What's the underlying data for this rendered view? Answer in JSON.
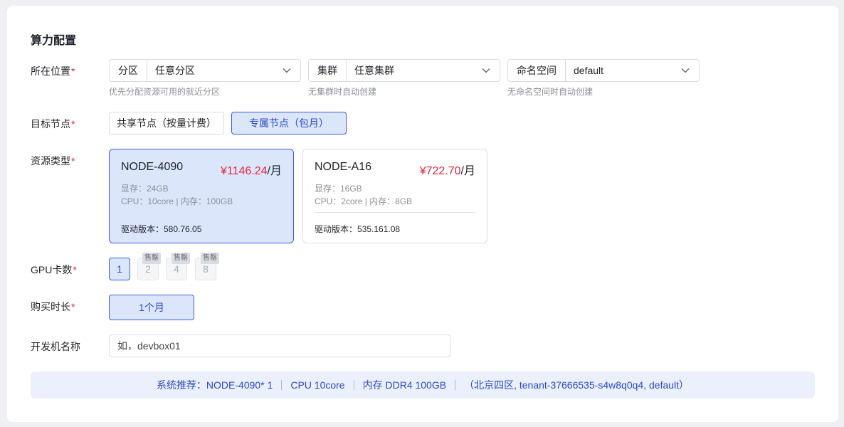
{
  "section_title": "算力配置",
  "location": {
    "label": "所在位置",
    "required_mark": "*",
    "partition": {
      "prefix": "分区",
      "value": "任意分区",
      "hint": "优先分配资源可用的就近分区"
    },
    "cluster": {
      "prefix": "集群",
      "value": "任意集群",
      "hint": "无集群时自动创建"
    },
    "namespace": {
      "prefix": "命名空间",
      "value": "default",
      "hint": "无命名空间时自动创建"
    }
  },
  "target_node": {
    "label": "目标节点",
    "required_mark": "*",
    "options": [
      {
        "label": "共享节点（按量计费）",
        "selected": false
      },
      {
        "label": "专属节点（包月）",
        "selected": true
      }
    ]
  },
  "resource_type": {
    "label": "资源类型",
    "required_mark": "*",
    "cards": [
      {
        "name": "NODE-4090",
        "price": "¥1146.24",
        "unit": "/月",
        "vram": "显存：24GB",
        "cpu_mem": "CPU：10core | 内存：100GB",
        "driver": "驱动版本：580.76.05",
        "selected": true
      },
      {
        "name": "NODE-A16",
        "price": "¥722.70",
        "unit": "/月",
        "vram": "显存：16GB",
        "cpu_mem": "CPU：2core | 内存：8GB",
        "driver": "驱动版本：535.161.08",
        "selected": false
      }
    ]
  },
  "gpu_count": {
    "label": "GPU卡数",
    "required_mark": "*",
    "options": [
      {
        "value": "1",
        "selected": true,
        "tag": ""
      },
      {
        "value": "2",
        "selected": false,
        "tag": "售罄"
      },
      {
        "value": "4",
        "selected": false,
        "tag": "售罄"
      },
      {
        "value": "8",
        "selected": false,
        "tag": "售罄"
      }
    ]
  },
  "duration": {
    "label": "购买时长",
    "required_mark": "*",
    "options": [
      {
        "label": "1个月",
        "selected": true
      }
    ]
  },
  "devbox_name": {
    "label": "开发机名称",
    "placeholder": "如，devbox01"
  },
  "summary": {
    "recommend": "系统推荐：NODE-4090* 1",
    "cpu": "CPU 10core",
    "memory": "内存 DDR4 100GB",
    "location": "（北京四区, tenant-37666535-s4w8q0q4, default）"
  },
  "colors": {
    "accent": "#2b4acb",
    "selected_bg": "#dce6fb",
    "price": "#e5243b",
    "required": "#e5243b"
  }
}
